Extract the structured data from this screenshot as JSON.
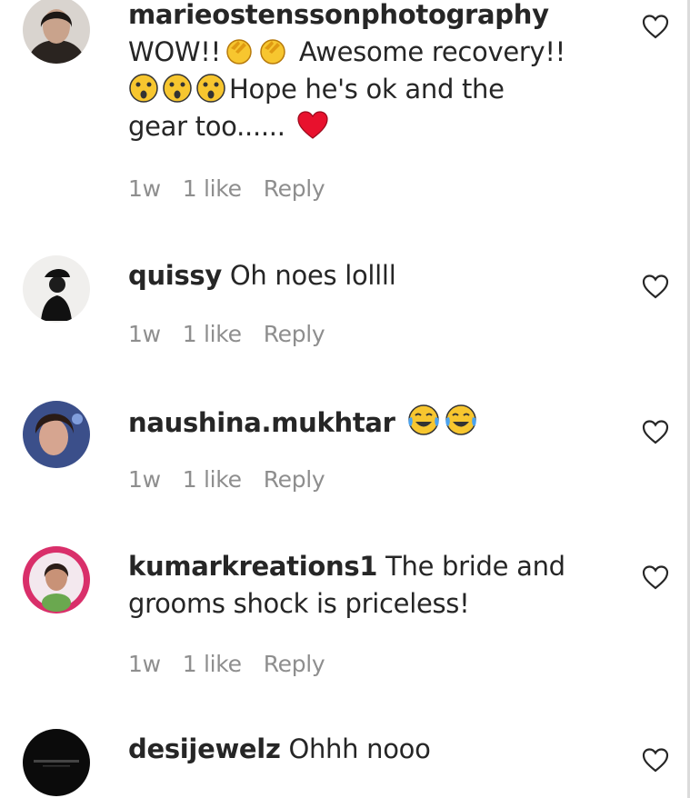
{
  "comments": [
    {
      "username": "marieostenssonphotography",
      "text_a": "WOW!!",
      "text_b": "Awesome recovery!!",
      "text_c": "Hope he's ok and the",
      "text_d": "gear too......",
      "time": "1w",
      "likes": "1 like",
      "reply": "Reply",
      "emoji": [
        "clapping-hands",
        "clapping-hands",
        "astonished-face",
        "astonished-face",
        "astonished-face",
        "red-heart"
      ]
    },
    {
      "username": "quissy",
      "text": "Oh noes lollll",
      "time": "1w",
      "likes": "1 like",
      "reply": "Reply"
    },
    {
      "username": "naushina.mukhtar",
      "text": "",
      "time": "1w",
      "likes": "1 like",
      "reply": "Reply",
      "emoji": [
        "tears-of-joy-face",
        "tears-of-joy-face"
      ]
    },
    {
      "username": "kumarkreations1",
      "text": "The bride and grooms shock is priceless!",
      "time": "1w",
      "likes": "1 like",
      "reply": "Reply"
    },
    {
      "username": "desijewelz",
      "text": "Ohhh nooo",
      "time": "",
      "likes": "",
      "reply": ""
    }
  ],
  "colors": {
    "text": "#262626",
    "meta": "#8e8e8e",
    "heart": "#262626",
    "emoji_yellow": "#f7c62f",
    "heart_red": "#e8112d"
  }
}
